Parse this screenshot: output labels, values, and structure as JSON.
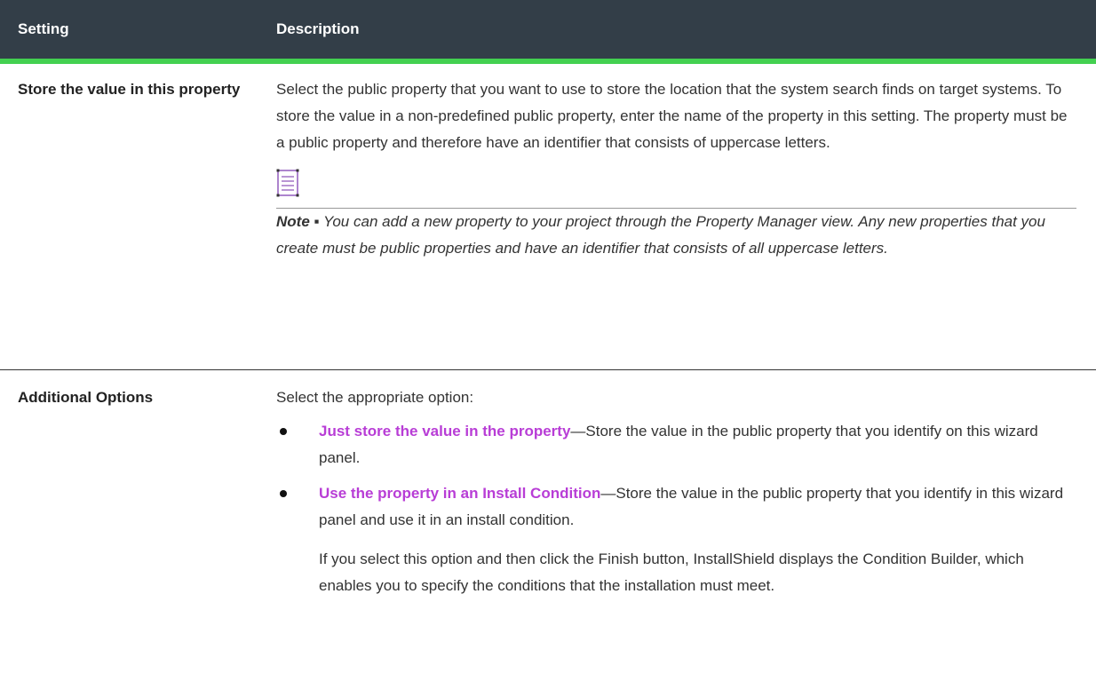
{
  "table": {
    "header": {
      "setting": "Setting",
      "description": "Description"
    },
    "rows": [
      {
        "setting": "Store the value in this property",
        "description": "Select the public property that you want to use to store the location that the system search finds on target systems. To store the value in a non-predefined public property, enter the name of the property in this setting. The property must be a public property and therefore have an identifier that consists of uppercase letters.",
        "note_label": "Note ▪",
        "note_text": "You can add a new property to your project through the Property Manager view. Any new properties that you create must be public properties and have an identifier that consists of all uppercase letters."
      },
      {
        "setting": "Additional Options",
        "intro": "Select the appropriate option:",
        "options": [
          {
            "link": "Just store the value in the property",
            "text": "—Store the value in the public property that you identify on this wizard panel."
          },
          {
            "link": "Use the property in an Install Condition",
            "text": "—Store the value in the public property that you identify in this wizard panel and use it in an install condition.",
            "extra": "If you select this option and then click the Finish button, InstallShield displays the Condition Builder, which enables you to specify the conditions that the installation must meet."
          }
        ]
      }
    ]
  },
  "colors": {
    "header_bg": "#333e48",
    "header_accent": "#43d050",
    "link": "#b83dd6",
    "note_icon": "#8a4fb8"
  },
  "icons": {
    "note": "note-icon"
  }
}
